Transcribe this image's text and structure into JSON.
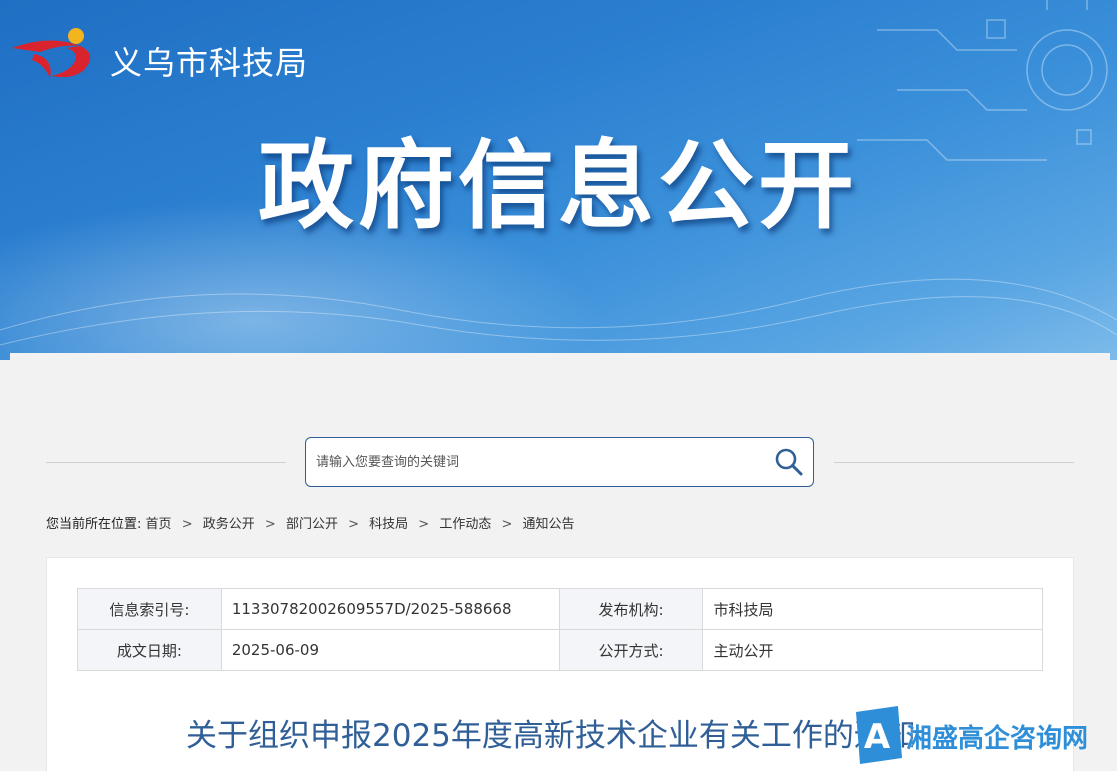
{
  "header": {
    "site_name": "义乌市科技局",
    "banner_title": "政府信息公开"
  },
  "search": {
    "placeholder": "请输入您要查询的关键词"
  },
  "breadcrumb": {
    "lead": "您当前所在位置:",
    "items": [
      "首页",
      "政务公开",
      "部门公开",
      "科技局",
      "工作动态",
      "通知公告"
    ]
  },
  "meta": {
    "index_label": "信息索引号:",
    "index_value": "11330782002609557D/2025-588668",
    "org_label": "发布机构:",
    "org_value": "市科技局",
    "date_label": "成文日期:",
    "date_value": "2025-06-09",
    "mode_label": "公开方式:",
    "mode_value": "主动公开"
  },
  "article": {
    "title": "关于组织申报2025年度高新技术企业有关工作的通知"
  },
  "watermark": {
    "text": "湘盛高企咨询网"
  },
  "colors": {
    "banner_blue": "#2b7fd0",
    "title_blue": "#2f5f96",
    "watermark_blue": "#2e8fd8"
  }
}
